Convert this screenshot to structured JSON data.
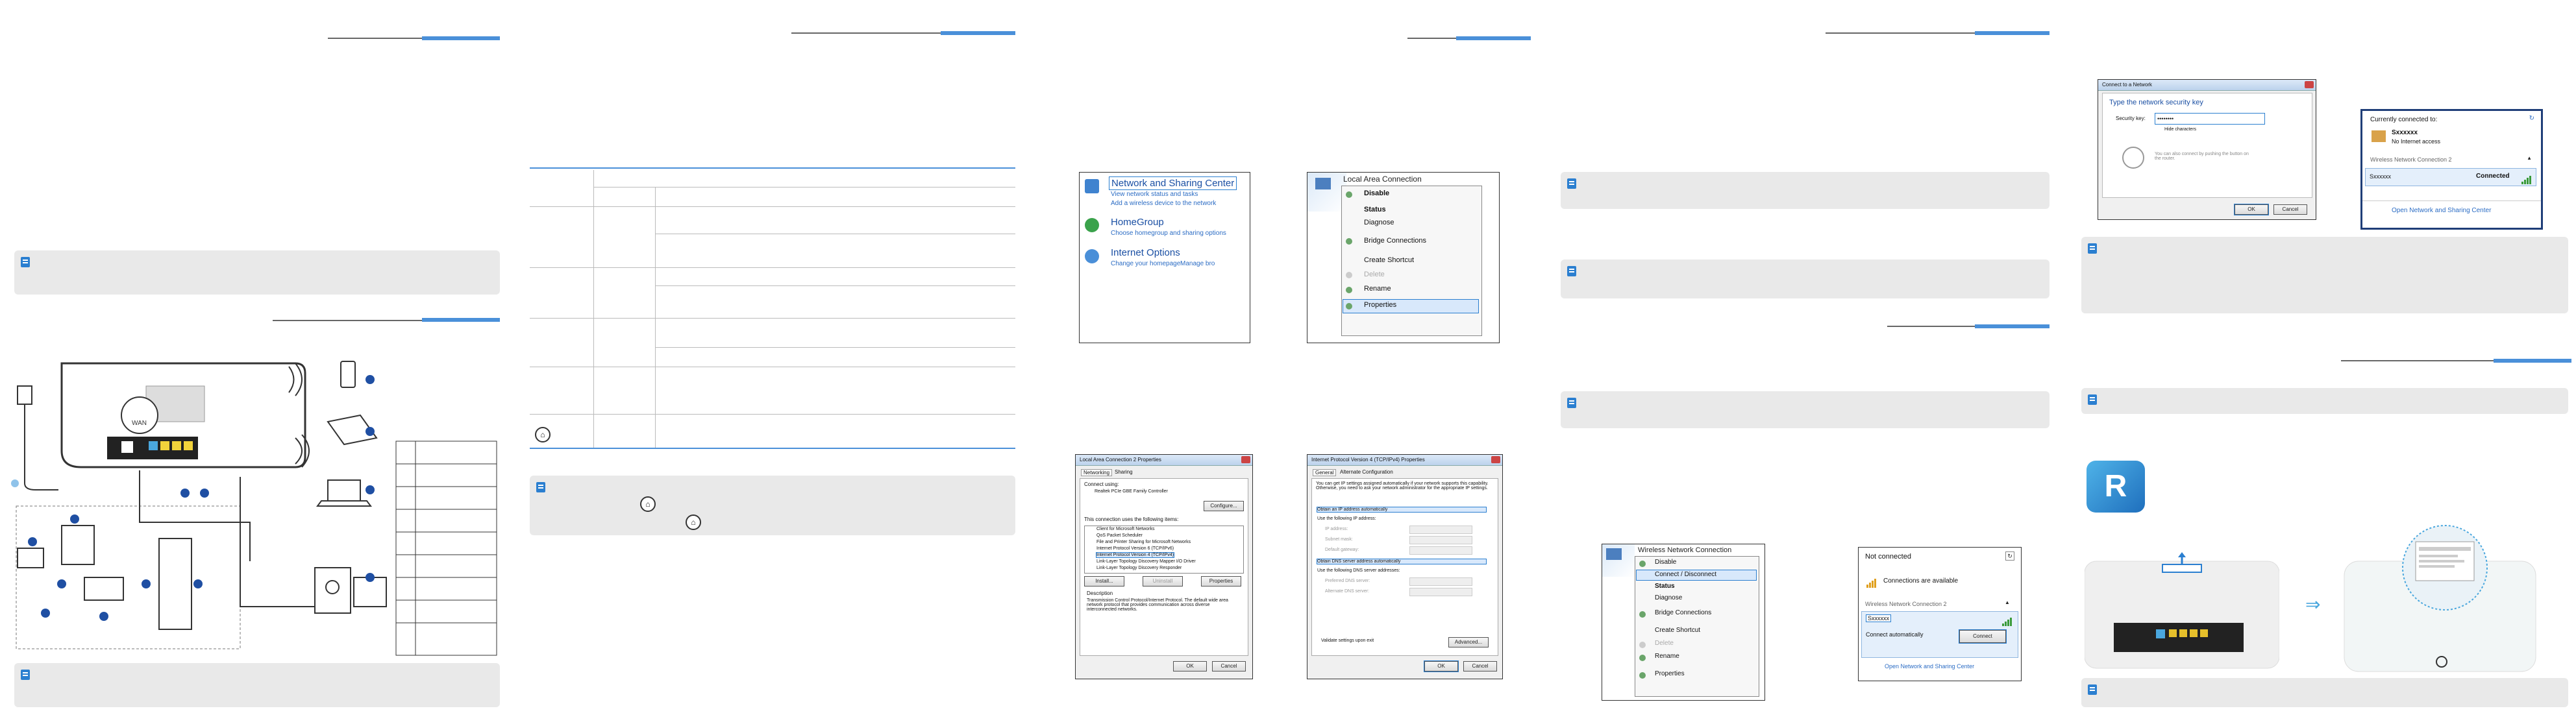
{
  "panel2_table": {
    "home_icon": "home-icon"
  },
  "panel3": {
    "control_panel": {
      "title": "Network and Sharing Center",
      "link1": "View network status and tasks",
      "link2": "Add a wireless device to the network",
      "homegroup": "HomeGroup",
      "homegroup_link": "Choose homegroup and sharing options",
      "internet_options": "Internet Options",
      "io_link1": "Change your homepage",
      "io_link2": "Manage bro"
    },
    "lan_menu": {
      "title": "Local Area Connection",
      "items": [
        "Disable",
        "Status",
        "Diagnose",
        "Bridge Connections",
        "Create Shortcut",
        "Delete",
        "Rename",
        "Properties"
      ]
    },
    "lan_props": {
      "title": "Local Area Connection 2 Properties",
      "tab1": "Networking",
      "tab2": "Sharing",
      "connect_using": "Connect using:",
      "adapter": "Realtek PCIe GBE Family Controller",
      "configure": "Configure...",
      "items_label": "This connection uses the following items:",
      "items": [
        "Client for Microsoft Networks",
        "QoS Packet Scheduler",
        "File and Printer Sharing for Microsoft Networks",
        "Internet Protocol Version 6 (TCP/IPv6)",
        "Internet Protocol Version 4 (TCP/IPv4)",
        "Link-Layer Topology Discovery Mapper I/O Driver",
        "Link-Layer Topology Discovery Responder"
      ],
      "install": "Install...",
      "uninstall": "Uninstall",
      "properties": "Properties",
      "desc_title": "Description",
      "desc": "Transmission Control Protocol/Internet Protocol. The default wide area network protocol that provides communication across diverse interconnected networks.",
      "ok": "OK",
      "cancel": "Cancel"
    },
    "ipv4": {
      "title": "Internet Protocol Version 4 (TCP/IPv4) Properties",
      "tab1": "General",
      "tab2": "Alternate Configuration",
      "intro": "You can get IP settings assigned automatically if your network supports this capability. Otherwise, you need to ask your network administrator for the appropriate IP settings.",
      "auto_ip": "Obtain an IP address automatically",
      "manual_ip": "Use the following IP address:",
      "ip_label": "IP address:",
      "mask_label": "Subnet mask:",
      "gw_label": "Default gateway:",
      "auto_dns": "Obtain DNS server address automatically",
      "manual_dns": "Use the following DNS server addresses:",
      "pdns": "Preferred DNS server:",
      "adns": "Alternate DNS server:",
      "validate": "Validate settings upon exit",
      "advanced": "Advanced...",
      "ok": "OK",
      "cancel": "Cancel"
    }
  },
  "panel4": {
    "wifi_menu": {
      "title": "Wireless Network Connection",
      "items": [
        "Disable",
        "Connect / Disconnect",
        "Status",
        "Diagnose",
        "Bridge Connections",
        "Create Shortcut",
        "Delete",
        "Rename",
        "Properties"
      ]
    },
    "wifi_list": {
      "status": "Not connected",
      "available": "Connections are available",
      "group": "Wireless Network Connection 2",
      "ssid": "Sxxxxxx",
      "auto": "Connect automatically",
      "connect": "Connect",
      "footer": "Open Network and Sharing Center"
    }
  },
  "panel5": {
    "connect_dialog": {
      "title": "Connect to a Network",
      "heading": "Type the network security key",
      "key_label": "Security key:",
      "key_value": "••••••••",
      "hide": "Hide characters",
      "wps": "You can also connect by pushing the button on the router.",
      "ok": "OK",
      "cancel": "Cancel"
    },
    "connected_popup": {
      "current": "Currently connected to:",
      "name": "Sxxxxxx",
      "access": "No Internet access",
      "group": "Wireless Network Connection 2",
      "ssid": "Sxxxxxx",
      "state": "Connected",
      "footer": "Open Network and Sharing Center"
    }
  },
  "panel1": {
    "wan_label": "WAN"
  }
}
